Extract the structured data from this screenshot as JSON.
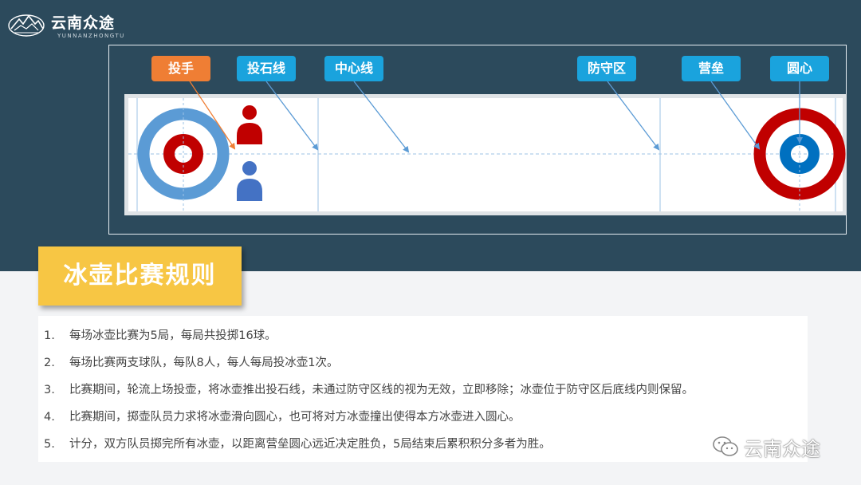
{
  "brand": {
    "name": "云南众途",
    "sub": "YUNNANZHONGTU"
  },
  "diagram": {
    "tags": [
      {
        "label": "投手",
        "color": "#ef7e34"
      },
      {
        "label": "投石线",
        "color": "#1aa3dd"
      },
      {
        "label": "中心线",
        "color": "#1aa3dd"
      },
      {
        "label": "防守区",
        "color": "#1aa3dd"
      },
      {
        "label": "营垒",
        "color": "#1aa3dd"
      },
      {
        "label": "圆心",
        "color": "#1aa3dd"
      }
    ],
    "colors": {
      "house_left_outer": "#5b9bd5",
      "house_left_inner": "#c00000",
      "house_right_outer": "#c00000",
      "house_right_inner": "#0070c0",
      "player_red": "#c00000",
      "player_blue": "#4472c4"
    }
  },
  "title": "冰壶比赛规则",
  "rules": [
    {
      "num": "1.",
      "text": "每场冰壶比赛为5局，每局共投掷16球。"
    },
    {
      "num": "2.",
      "text": "每场比赛两支球队，每队8人，每人每局投冰壶1次。"
    },
    {
      "num": "3.",
      "text": "比赛期间，轮流上场投壶，将冰壶推出投石线，未通过防守区线的视为无效，立即移除；冰壶位于防守区后底线内则保留。"
    },
    {
      "num": "4.",
      "text": "比赛期间，掷壶队员力求将冰壶滑向圆心，也可将对方冰壶撞出使得本方冰壶进入圆心。"
    },
    {
      "num": "5.",
      "text": "计分，双方队员掷完所有冰壶，以距离营垒圆心远近决定胜负，5局结束后累积积分多者为胜。"
    }
  ],
  "watermark": "云南众途"
}
